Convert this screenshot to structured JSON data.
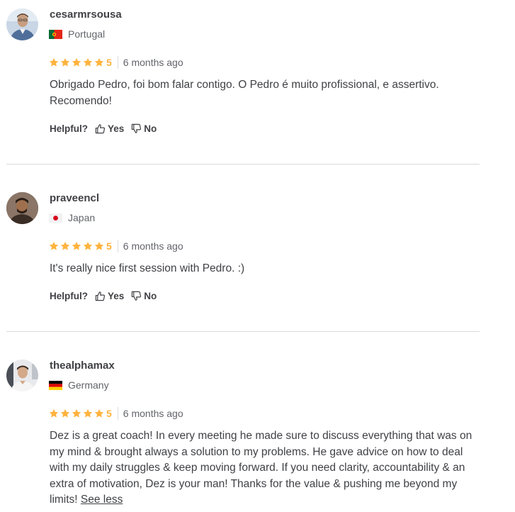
{
  "helpful_label": "Helpful?",
  "yes_label": "Yes",
  "no_label": "No",
  "see_less_label": "See less",
  "star_color": "#ffb33e",
  "reviews": [
    {
      "username": "cesarmrsousa",
      "country": "Portugal",
      "rating": "5",
      "time": "6 months ago",
      "text": "Obrigado Pedro, foi bom falar contigo. O Pedro é muito profissional, e assertivo. Recomendo!"
    },
    {
      "username": "praveencl",
      "country": "Japan",
      "rating": "5",
      "time": "6 months ago",
      "text": "It's really nice first session with Pedro. :)"
    },
    {
      "username": "thealphamax",
      "country": "Germany",
      "rating": "5",
      "time": "6 months ago",
      "text": "Dez is a great coach! In every meeting he made sure to discuss everything that was on my mind & brought always a solution to my problems. He gave advice on how to deal with my daily struggles & keep moving forward. If you need clarity, accountability & an extra of motivation, Dez is your man! Thanks for the value & pushing me beyond my limits! "
    }
  ]
}
